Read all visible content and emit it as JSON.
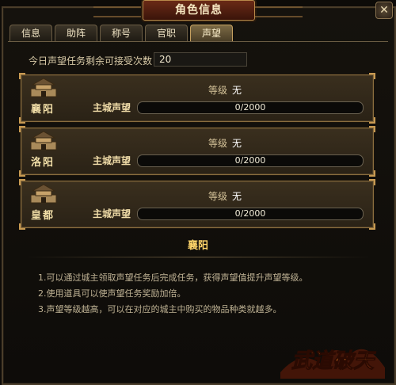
{
  "window": {
    "title": "角色信息",
    "close_glyph": "✕"
  },
  "tabs": [
    {
      "label": "信息",
      "active": false
    },
    {
      "label": "助阵",
      "active": false
    },
    {
      "label": "称号",
      "active": false
    },
    {
      "label": "官职",
      "active": false
    },
    {
      "label": "声望",
      "active": true
    }
  ],
  "quota": {
    "label": "今日声望任务剩余可接受次数：",
    "value": "20"
  },
  "cities": [
    {
      "name": "襄阳",
      "level_label": "等级",
      "level_value": "无",
      "rep_label": "主城声望",
      "progress_text": "0/2000",
      "progress": 0
    },
    {
      "name": "洛阳",
      "level_label": "等级",
      "level_value": "无",
      "rep_label": "主城声望",
      "progress_text": "0/2000",
      "progress": 0
    },
    {
      "name": "皇都",
      "level_label": "等级",
      "level_value": "无",
      "rep_label": "主城声望",
      "progress_text": "0/2000",
      "progress": 0
    }
  ],
  "detail": {
    "title": "襄阳",
    "lines": [
      "1.可以通过城主领取声望任务后完成任务，获得声望值提升声望等级。",
      "2.使用道具可以使声望任务奖励加倍。",
      "3.声望等级越高，可以在对应的城主中购买的物品种类就越多。"
    ]
  },
  "logo": {
    "text": "武道破天"
  },
  "colors": {
    "accent": "#ffd56a",
    "title_plate": "#6a2a16",
    "bar_fill": "#6f5630"
  }
}
